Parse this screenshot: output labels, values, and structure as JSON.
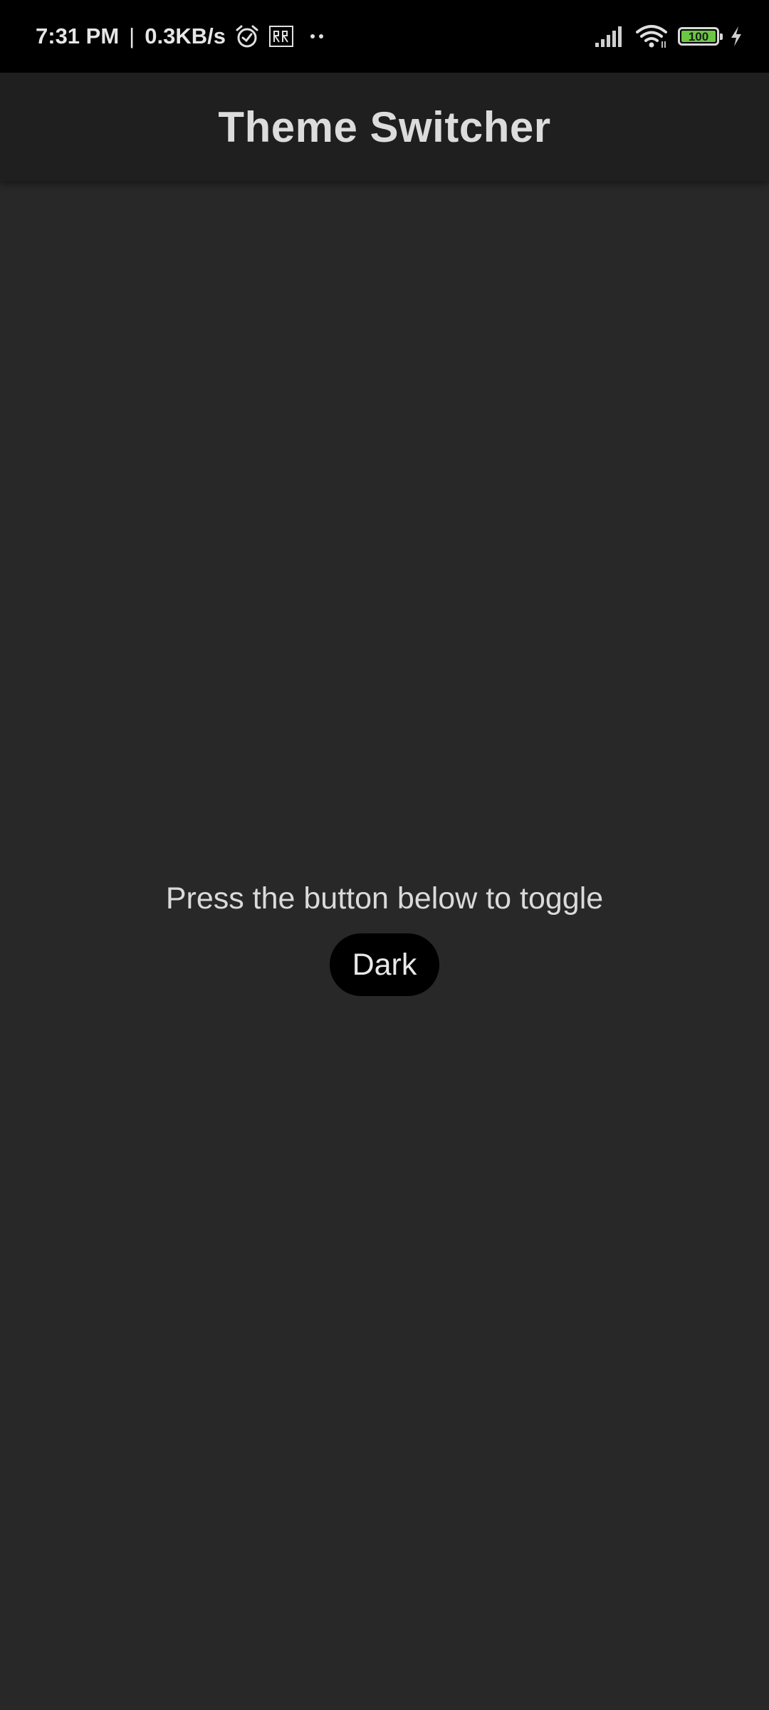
{
  "status_bar": {
    "time": "7:31 PM",
    "separator": "|",
    "network_speed": "0.3KB/s",
    "icons_left": [
      "alarm-icon",
      "rr-app-icon",
      "more-dots-icon"
    ],
    "icons_right": [
      "signal-icon",
      "wifi-icon",
      "battery-icon",
      "charging-icon"
    ],
    "battery_level": "100",
    "battery_color": "#6cc644"
  },
  "app_bar": {
    "title": "Theme Switcher",
    "background": "#1f1f1f"
  },
  "main": {
    "prompt": "Press the button below to toggle",
    "toggle_button_label": "Dark",
    "background": "#282828",
    "button_color": "#000000"
  }
}
